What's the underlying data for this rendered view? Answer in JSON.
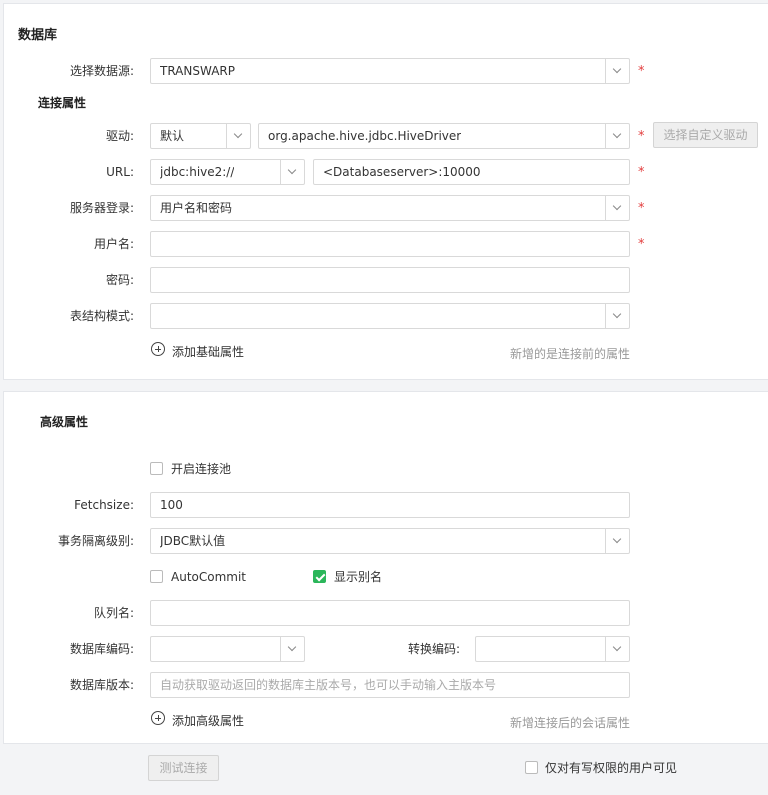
{
  "database": {
    "title": "数据库",
    "datasource": {
      "label": "选择数据源:",
      "value": "TRANSWARP"
    }
  },
  "connection": {
    "title": "连接属性",
    "driver": {
      "label": "驱动:",
      "type": "默认",
      "value": "org.apache.hive.jdbc.HiveDriver",
      "custom_button": "选择自定义驱动"
    },
    "url": {
      "label": "URL:",
      "prefix": "jdbc:hive2://",
      "value": "<Databaseserver>:10000"
    },
    "server_login": {
      "label": "服务器登录:",
      "value": "用户名和密码"
    },
    "username": {
      "label": "用户名:",
      "value": ""
    },
    "password": {
      "label": "密码:",
      "value": ""
    },
    "schema": {
      "label": "表结构模式:",
      "value": ""
    },
    "add_basic": "添加基础属性",
    "add_basic_hint": "新增的是连接前的属性"
  },
  "advanced": {
    "title": "高级属性",
    "pool": {
      "label": "开启连接池",
      "checked": false
    },
    "fetchsize": {
      "label": "Fetchsize:",
      "value": "100"
    },
    "isolation": {
      "label": "事务隔离级别:",
      "value": "JDBC默认值"
    },
    "autocommit": {
      "label": "AutoCommit",
      "checked": false
    },
    "show_alias": {
      "label": "显示别名",
      "checked": true
    },
    "queue": {
      "label": "队列名:",
      "value": ""
    },
    "db_encoding": {
      "label": "数据库编码:",
      "value": ""
    },
    "convert_encoding": {
      "label": "转换编码:",
      "value": ""
    },
    "db_version": {
      "label": "数据库版本:",
      "placeholder": "自动获取驱动返回的数据库主版本号，也可以手动输入主版本号"
    },
    "add_advanced": "添加高级属性",
    "add_advanced_hint": "新增连接后的会话属性"
  },
  "footer": {
    "test_button": "测试连接",
    "writable_only": {
      "label": "仅对有写权限的用户可见",
      "checked": false
    }
  },
  "required_mark": "*",
  "colors": {
    "required": "#e23d3d",
    "check_green": "#2bb65a",
    "border": "#d9d9d9"
  }
}
